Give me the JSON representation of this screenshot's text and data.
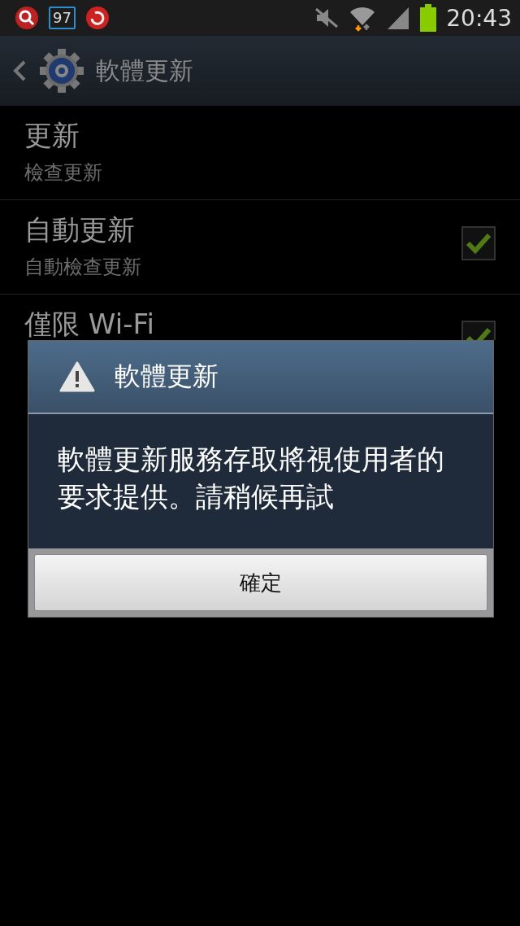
{
  "status_bar": {
    "badge": "97",
    "time": "20:43"
  },
  "action_bar": {
    "title": "軟體更新"
  },
  "settings": [
    {
      "kind": "plain",
      "title": "更新",
      "subtitle": "檢查更新"
    },
    {
      "kind": "checkbox",
      "title": "自動更新",
      "subtitle": "自動檢查更新",
      "checked": true
    },
    {
      "kind": "checkbox",
      "title": "僅限 Wi-Fi",
      "checked": true
    }
  ],
  "dialog": {
    "title": "軟體更新",
    "message": "軟體更新服務存取將視使用者的要求提供。請稍候再試",
    "button": "確定"
  }
}
